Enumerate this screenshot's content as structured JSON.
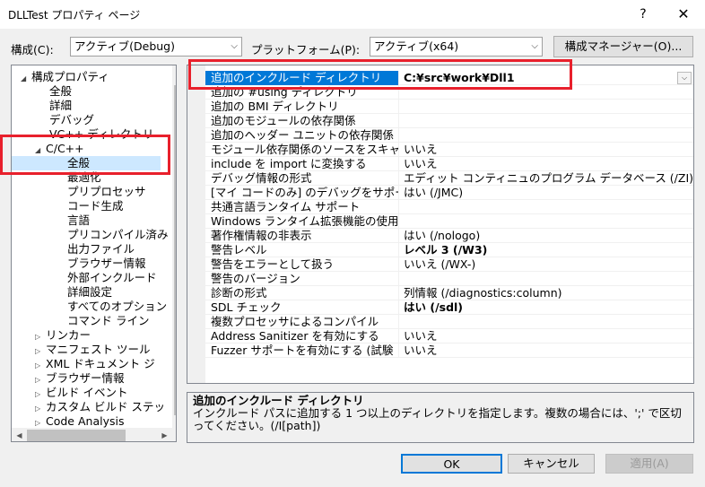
{
  "window": {
    "title": "DLLTest プロパティ ページ",
    "help": "?",
    "close": "✕"
  },
  "toolbar": {
    "config_label": "構成(C):",
    "config_value": "アクティブ(Debug)",
    "platform_label": "プラットフォーム(P):",
    "platform_value": "アクティブ(x64)",
    "manager_button": "構成マネージャー(O)..."
  },
  "tree": {
    "items": [
      {
        "label": "構成プロパティ",
        "toggle": "◢"
      },
      {
        "label": "全般"
      },
      {
        "label": "詳細"
      },
      {
        "label": "デバッグ"
      },
      {
        "label": "VC++ ディレクトリ"
      },
      {
        "label": "C/C++",
        "toggle": "◢"
      },
      {
        "label": "全般"
      },
      {
        "label": "最適化"
      },
      {
        "label": "プリプロセッサ"
      },
      {
        "label": "コード生成"
      },
      {
        "label": "言語"
      },
      {
        "label": "プリコンパイル済み"
      },
      {
        "label": "出力ファイル"
      },
      {
        "label": "ブラウザー情報"
      },
      {
        "label": "外部インクルード"
      },
      {
        "label": "詳細設定"
      },
      {
        "label": "すべてのオプション"
      },
      {
        "label": "コマンド ライン"
      },
      {
        "label": "リンカー",
        "toggle": "▷"
      },
      {
        "label": "マニフェスト ツール",
        "toggle": "▷"
      },
      {
        "label": "XML ドキュメント ジ",
        "toggle": "▷"
      },
      {
        "label": "ブラウザー情報",
        "toggle": "▷"
      },
      {
        "label": "ビルド イベント",
        "toggle": "▷"
      },
      {
        "label": "カスタム ビルド ステッ",
        "toggle": "▷"
      },
      {
        "label": "Code Analysis",
        "toggle": "▷"
      }
    ]
  },
  "grid": {
    "rows": [
      {
        "name": "追加のインクルード ディレクトリ",
        "value": "C:¥src¥work¥Dll1",
        "bold": true
      },
      {
        "name": "追加の #using ディレクトリ",
        "value": ""
      },
      {
        "name": "追加の BMI ディレクトリ",
        "value": ""
      },
      {
        "name": "追加のモジュールの依存関係",
        "value": ""
      },
      {
        "name": "追加のヘッダー ユニットの依存関係",
        "value": ""
      },
      {
        "name": "モジュール依存関係のソースをスキャ",
        "value": "いいえ"
      },
      {
        "name": "include を import に変換する",
        "value": "いいえ"
      },
      {
        "name": "デバッグ情報の形式",
        "value": "エディット コンティニュのプログラム データベース (/ZI)"
      },
      {
        "name": "[マイ コードのみ] のデバッグをサポー",
        "value": "はい (/JMC)"
      },
      {
        "name": "共通言語ランタイム サポート",
        "value": ""
      },
      {
        "name": "Windows ランタイム拡張機能の使用",
        "value": ""
      },
      {
        "name": "著作権情報の非表示",
        "value": "はい (/nologo)"
      },
      {
        "name": "警告レベル",
        "value": "レベル 3 (/W3)",
        "bold": true
      },
      {
        "name": "警告をエラーとして扱う",
        "value": "いいえ (/WX-)"
      },
      {
        "name": "警告のバージョン",
        "value": ""
      },
      {
        "name": "診断の形式",
        "value": "列情報 (/diagnostics:column)"
      },
      {
        "name": "SDL チェック",
        "value": "はい (/sdl)",
        "bold": true
      },
      {
        "name": "複数プロセッサによるコンパイル",
        "value": ""
      },
      {
        "name": "Address Sanitizer を有効にする",
        "value": "いいえ"
      },
      {
        "name": "Fuzzer サポートを有効にする (試験",
        "value": "いいえ"
      }
    ]
  },
  "description": {
    "title": "追加のインクルード ディレクトリ",
    "body": "インクルード パスに追加する 1 つ以上のディレクトリを指定します。複数の場合には、';' で区切ってください。(/I[path])"
  },
  "footer": {
    "ok": "OK",
    "cancel": "キャンセル",
    "apply": "適用(A)"
  },
  "colors": {
    "selection": "#0078d7",
    "highlight_box": "#e8202c",
    "tree_selection": "#cde8ff"
  }
}
